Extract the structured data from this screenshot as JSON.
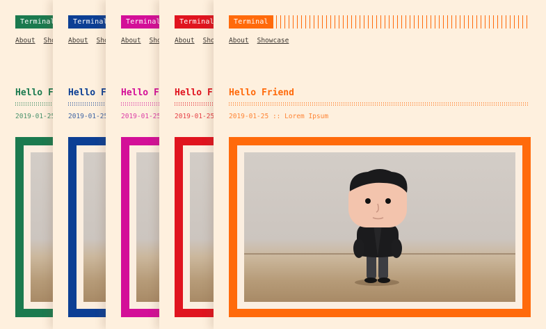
{
  "brand_label": "Terminal",
  "nav": {
    "about": "About",
    "showcase": "Showcase"
  },
  "post": {
    "title": "Hello Friend",
    "date": "2019-01-25",
    "separator": "::",
    "author": "Lorem Ipsum"
  },
  "themes": [
    {
      "name": "green",
      "color": "#1b7a4f"
    },
    {
      "name": "blue",
      "color": "#0c3f94"
    },
    {
      "name": "pink",
      "color": "#d30f98"
    },
    {
      "name": "red",
      "color": "#e0141f"
    },
    {
      "name": "orange",
      "color": "#ff6a0b"
    }
  ],
  "photo_subject": "funko-figure-photo"
}
